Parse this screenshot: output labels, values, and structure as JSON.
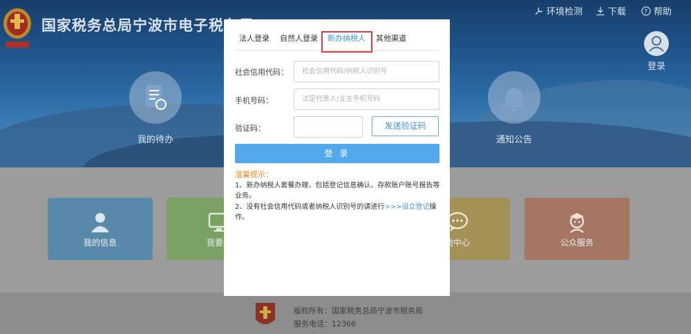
{
  "header": {
    "title": "国家税务总局宁波市电子税务局",
    "links": [
      {
        "label": "环境检测",
        "icon": "wrench-icon"
      },
      {
        "label": "下载",
        "icon": "download-icon"
      },
      {
        "label": "帮助",
        "icon": "help-circle-icon"
      }
    ],
    "login_label": "登录"
  },
  "banner": {
    "todo_label": "我的待办",
    "notice_label": "通知公告"
  },
  "tiles": [
    {
      "label": "我的信息",
      "icon": "user-icon",
      "color": "#5a8aaa"
    },
    {
      "label": "我要办",
      "icon": "monitor-icon",
      "color": "#7aa063"
    },
    {
      "label": "动中心",
      "icon": "chat-icon",
      "color": "#a39155"
    },
    {
      "label": "公众服务",
      "icon": "service-icon",
      "color": "#a57763"
    }
  ],
  "footer": {
    "copyright": "版权所有：国家税务总局宁波市税务局",
    "phone": "服务电话：12366"
  },
  "modal": {
    "tabs": [
      "法人登录",
      "自然人登录",
      "新办纳税人",
      "其他渠道"
    ],
    "active_tab": "新办纳税人",
    "fields": {
      "credit_code_label": "社会信用代码：",
      "credit_code_placeholder": "社会信用代码/纳税人识别号",
      "phone_label": "手机号码：",
      "phone_placeholder": "法定代表人/业主手机号码",
      "captcha_label": "验证码："
    },
    "send_code_label": "发送验证码",
    "login_label": "登 录",
    "tips_title": "温馨提示：",
    "tip1": "1、新办纳税人套餐办理，包括登记信息确认、存款账户账号报告等业务。",
    "tip2_text": "2、没有社会信用代码或者纳税人识别号的请进行",
    "tip2_link": ">>>设立登记",
    "tip2_suffix": "操作。"
  },
  "colors": {
    "accent": "#3b95dc",
    "login_button": "#53a8ec",
    "highlight": "#e23a3a",
    "tip_title": "#f08a1c"
  }
}
